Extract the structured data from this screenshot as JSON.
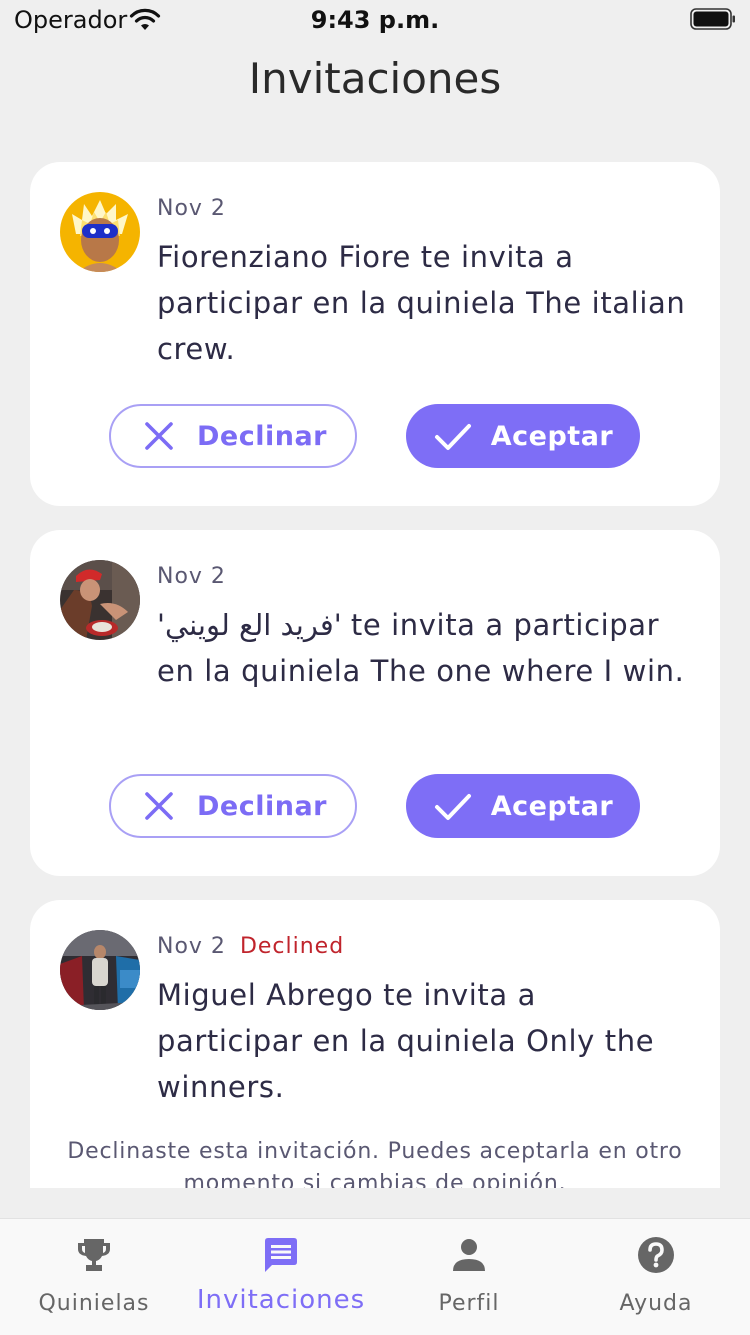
{
  "status_bar": {
    "carrier": "Operador",
    "time": "9:43 p.m."
  },
  "header": {
    "title": "Invitaciones"
  },
  "invitations": [
    {
      "date": "Nov 2",
      "status": "",
      "message": "Fiorenziano Fiore te invita a participar en la quiniela The italian crew.",
      "decline_label": "Declinar",
      "accept_label": "Aceptar"
    },
    {
      "date": "Nov 2",
      "status": "",
      "message": "'فريد الع لويني' te invita a participar en la quiniela The one where I win.",
      "decline_label": "Declinar",
      "accept_label": "Aceptar"
    },
    {
      "date": "Nov 2",
      "status": "Declined",
      "message": "Miguel Abrego te invita a participar en la quiniela Only the winners.",
      "note": "Declinaste esta invitación. Puedes aceptarla en otro momento si cambias de opinión."
    }
  ],
  "tab_bar": {
    "tabs": [
      {
        "label": "Quinielas",
        "icon": "trophy-icon",
        "active": false
      },
      {
        "label": "Invitaciones",
        "icon": "chat-icon",
        "active": true
      },
      {
        "label": "Perfil",
        "icon": "person-icon",
        "active": false
      },
      {
        "label": "Ayuda",
        "icon": "help-icon",
        "active": false
      }
    ]
  },
  "colors": {
    "accent": "#7e6ef6",
    "declined": "#c0242c",
    "background": "#efefef",
    "card": "#ffffff"
  }
}
